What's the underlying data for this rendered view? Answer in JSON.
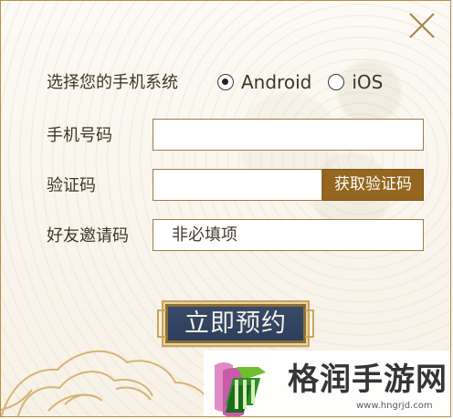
{
  "form": {
    "system_label": "选择您的手机系统",
    "options": [
      {
        "label": "Android",
        "checked": true
      },
      {
        "label": "iOS",
        "checked": false
      }
    ],
    "phone_label": "手机号码",
    "phone_value": "",
    "code_label": "验证码",
    "code_value": "",
    "code_button": "获取验证码",
    "invite_label": "好友邀请码",
    "invite_placeholder": "非必填项",
    "submit_label": "立即预约"
  },
  "watermark": {
    "name": "格润手游网",
    "url": "www.hngrjd.com"
  },
  "colors": {
    "accent": "#95661f",
    "border": "#a07d45",
    "button_blue": "#2b3d5a",
    "gold": "#caa65b"
  },
  "icons": {
    "close": "close-icon",
    "radio": "radio-icon",
    "logo": "brand-logo"
  }
}
